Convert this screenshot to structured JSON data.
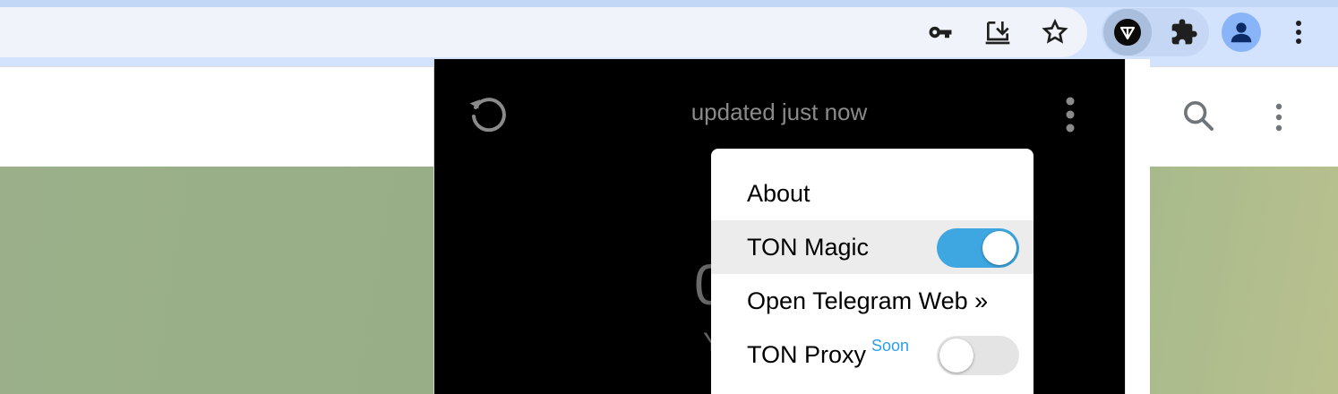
{
  "browser": {
    "icons": [
      "key-icon",
      "install-app-icon",
      "star-icon",
      "ton-extension-icon",
      "puzzle-icon",
      "profile-icon",
      "kebab-menu-icon"
    ],
    "colors": {
      "toolbar": "#d3e3fd",
      "omnibox": "#f0f4fa",
      "profile": "#8ab4f8",
      "icon": "#1f1f1f"
    }
  },
  "page": {
    "header_icons": [
      "search-icon",
      "kebab-menu-icon"
    ]
  },
  "popup": {
    "status": "updated just now",
    "balance_partial": "0",
    "subtext_partial": "Y",
    "icons": [
      "refresh-icon",
      "kebab-menu-icon"
    ]
  },
  "menu": {
    "about": "About",
    "ton_magic": "TON Magic",
    "ton_magic_enabled": true,
    "open_telegram_web": "Open Telegram Web »",
    "ton_proxy": "TON Proxy",
    "ton_proxy_badge": "Soon",
    "ton_proxy_enabled": false,
    "accent": "#3ea6e0",
    "badge_color": "#2a9ee8"
  }
}
